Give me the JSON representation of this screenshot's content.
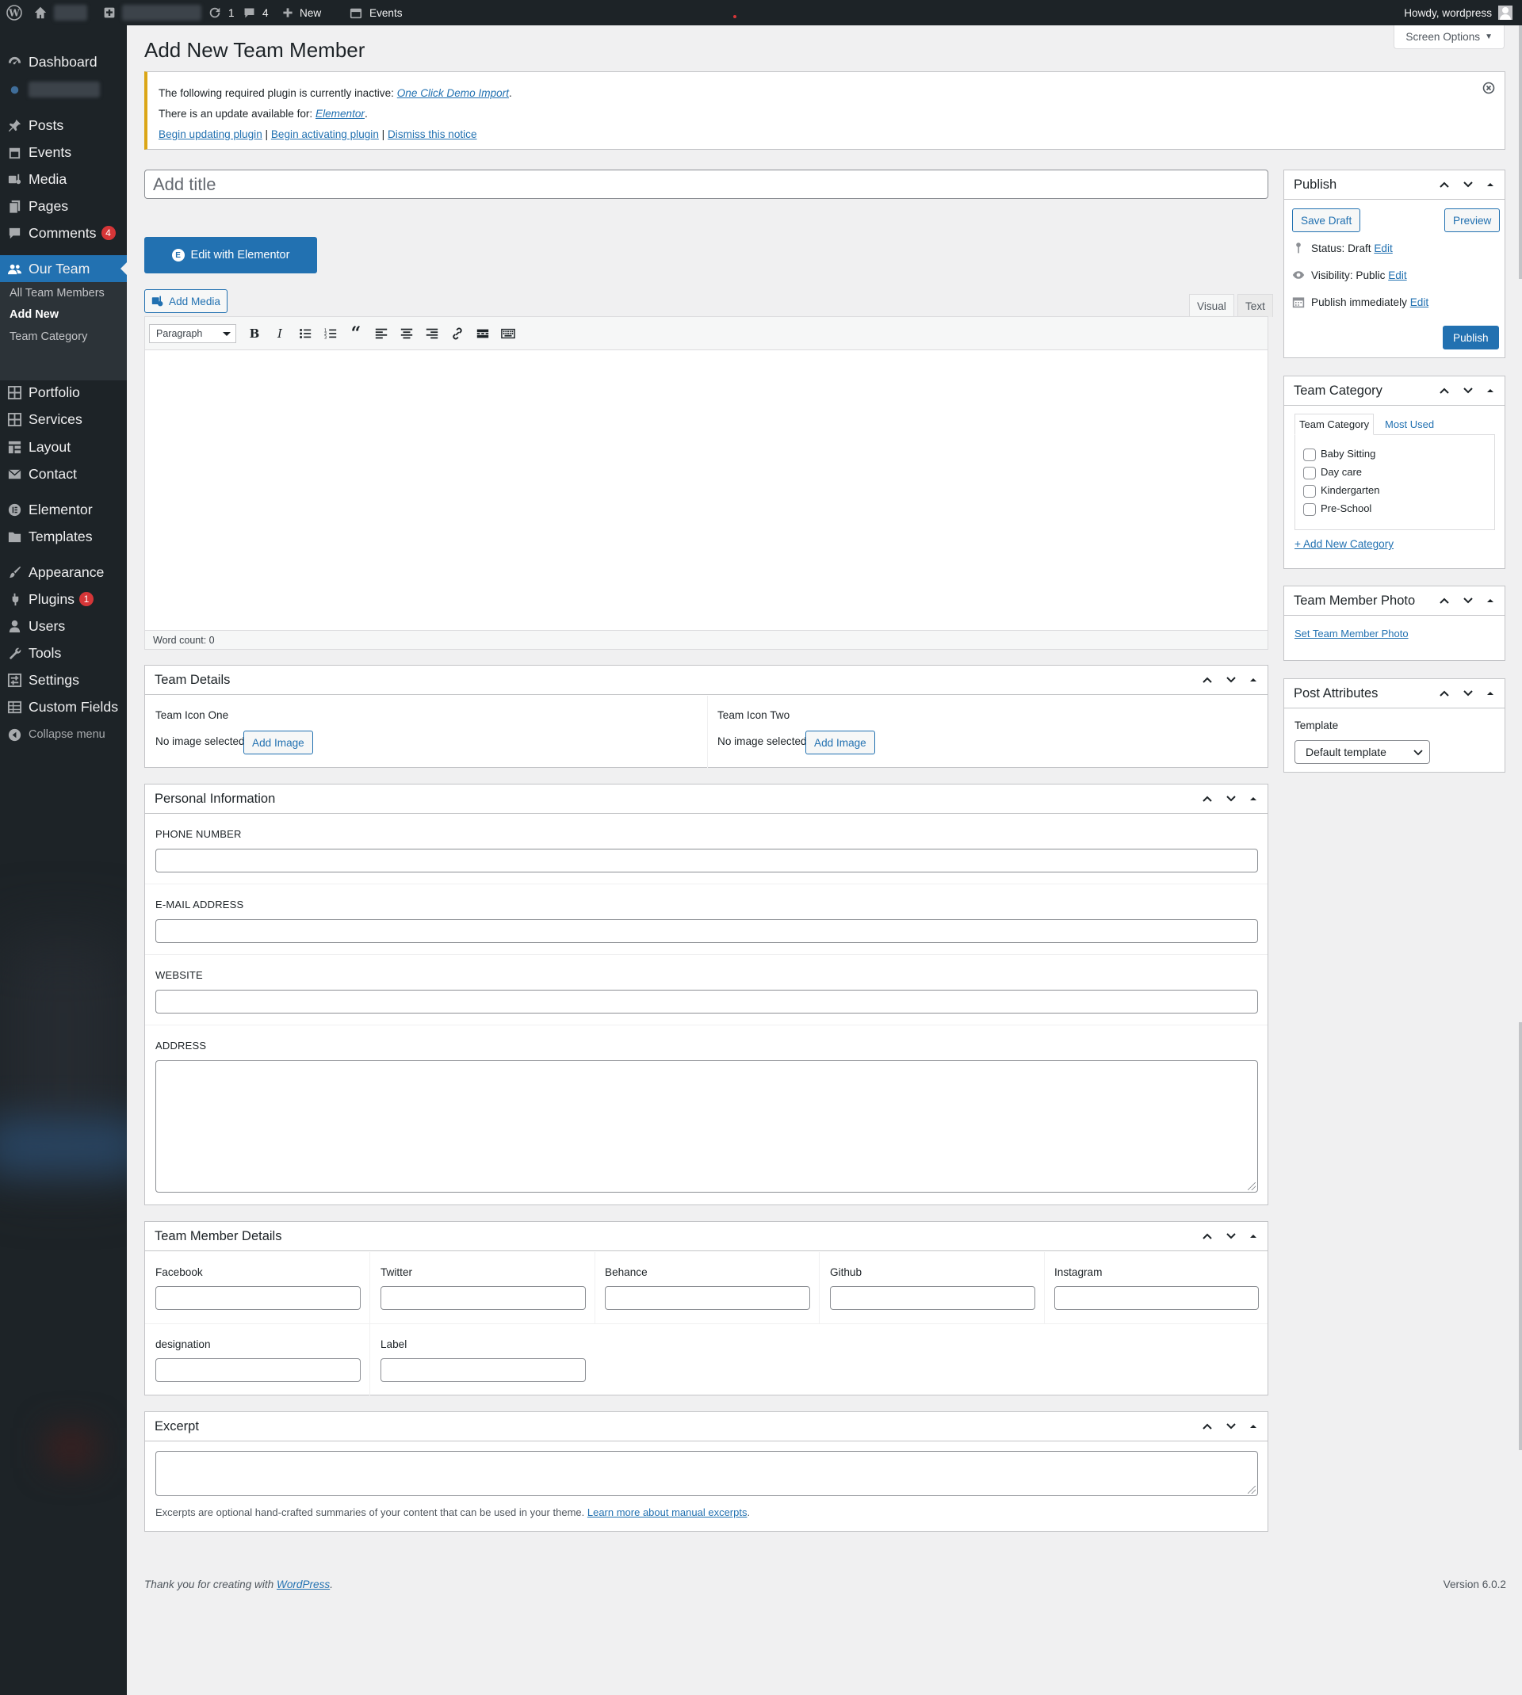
{
  "adminbar": {
    "updates_count": "1",
    "comments_count": "4",
    "new_label": "New",
    "events_label": "Events",
    "howdy": "Howdy, wordpress"
  },
  "sidebar": {
    "items": {
      "dashboard": "Dashboard",
      "posts": "Posts",
      "events": "Events",
      "media": "Media",
      "pages": "Pages",
      "comments": "Comments",
      "comments_badge": "4",
      "our_team": "Our Team",
      "portfolio": "Portfolio",
      "services": "Services",
      "layout": "Layout",
      "contact": "Contact",
      "elementor": "Elementor",
      "templates": "Templates",
      "appearance": "Appearance",
      "plugins": "Plugins",
      "plugins_badge": "1",
      "users": "Users",
      "tools": "Tools",
      "settings": "Settings",
      "custom_fields": "Custom Fields",
      "collapse": "Collapse menu"
    },
    "submenu": {
      "all": "All Team Members",
      "add_new": "Add New",
      "category": "Team Category"
    }
  },
  "header": {
    "title": "Add New Team Member",
    "screen_options": "Screen Options"
  },
  "notice": {
    "line1_prefix": "The following required plugin is currently inactive: ",
    "line1_link": "One Click Demo Import",
    "line1_suffix": ".",
    "line2_prefix": "There is an update available for: ",
    "line2_link": "Elementor",
    "line2_suffix": ".",
    "action_update": "Begin updating plugin",
    "sep": " | ",
    "action_activate": "Begin activating plugin",
    "action_dismiss": "Dismiss this notice"
  },
  "editor": {
    "title_placeholder": "Add title",
    "elementor_button": "Edit with Elementor",
    "add_media": "Add Media",
    "tab_visual": "Visual",
    "tab_text": "Text",
    "format": "Paragraph",
    "word_count": "Word count: 0"
  },
  "team_details": {
    "title": "Team Details",
    "icon_one_label": "Team Icon One",
    "icon_two_label": "Team Icon Two",
    "no_image": "No image selected",
    "add_image": "Add Image"
  },
  "personal_info": {
    "title": "Personal Information",
    "phone": "PHONE NUMBER",
    "email": "E-MAIL ADDRESS",
    "website": "WEBSITE",
    "address": "ADDRESS"
  },
  "member_details": {
    "title": "Team Member Details",
    "facebook": "Facebook",
    "twitter": "Twitter",
    "behance": "Behance",
    "github": "Github",
    "instagram": "Instagram",
    "designation": "designation",
    "label": "Label"
  },
  "excerpt": {
    "title": "Excerpt",
    "help": "Excerpts are optional hand-crafted summaries of your content that can be used in your theme. ",
    "learn_more": "Learn more about manual excerpts",
    "period": "."
  },
  "publish": {
    "title": "Publish",
    "save_draft": "Save Draft",
    "preview": "Preview",
    "status_label": "Status: ",
    "status_value": "Draft",
    "visibility_label": "Visibility: ",
    "visibility_value": "Public",
    "publish_label": "Publish ",
    "publish_value": "immediately",
    "edit": "Edit",
    "publish_button": "Publish"
  },
  "team_category": {
    "title": "Team Category",
    "tab_all": "Team Category",
    "tab_most_used": "Most Used",
    "categories": [
      "Baby Sitting",
      "Day care",
      "Kindergarten",
      "Pre-School"
    ],
    "add_new": "+ Add New Category"
  },
  "member_photo": {
    "title": "Team Member Photo",
    "set_photo": "Set Team Member Photo"
  },
  "post_attributes": {
    "title": "Post Attributes",
    "template_label": "Template",
    "template_value": "Default template"
  },
  "footer": {
    "thanks_prefix": "Thank you for creating with ",
    "thanks_link": "WordPress",
    "thanks_suffix": ".",
    "version": "Version 6.0.2"
  }
}
